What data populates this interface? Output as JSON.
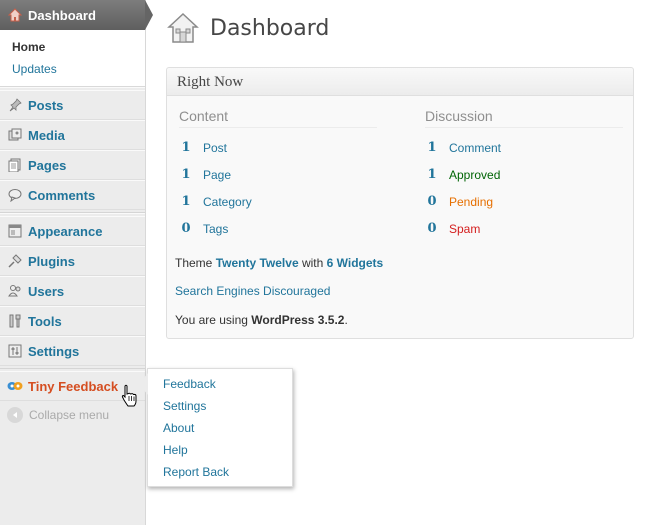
{
  "sidebar": {
    "dashboard_label": "Dashboard",
    "submenu": [
      {
        "label": "Home",
        "current": true
      },
      {
        "label": "Updates",
        "current": false
      }
    ],
    "group1": [
      {
        "label": "Posts",
        "icon": "pushpin-icon"
      },
      {
        "label": "Media",
        "icon": "media-icon"
      },
      {
        "label": "Pages",
        "icon": "pages-icon"
      },
      {
        "label": "Comments",
        "icon": "comment-bubble-icon"
      }
    ],
    "group2": [
      {
        "label": "Appearance",
        "icon": "appearance-icon"
      },
      {
        "label": "Plugins",
        "icon": "plug-icon"
      },
      {
        "label": "Users",
        "icon": "users-icon"
      },
      {
        "label": "Tools",
        "icon": "tools-icon"
      },
      {
        "label": "Settings",
        "icon": "settings-icon"
      }
    ],
    "tiny_feedback_label": "Tiny Feedback",
    "collapse_label": "Collapse menu"
  },
  "flyout": {
    "items": [
      "Feedback",
      "Settings",
      "About",
      "Help",
      "Report Back"
    ]
  },
  "page": {
    "title": "Dashboard"
  },
  "right_now": {
    "title": "Right Now",
    "content_heading": "Content",
    "discussion_heading": "Discussion",
    "content": [
      {
        "count": "1",
        "label": "Post"
      },
      {
        "count": "1",
        "label": "Page"
      },
      {
        "count": "1",
        "label": "Category"
      },
      {
        "count": "0",
        "label": "Tags"
      }
    ],
    "discussion": [
      {
        "count": "1",
        "label": "Comment"
      },
      {
        "count": "1",
        "label": "Approved"
      },
      {
        "count": "0",
        "label": "Pending"
      },
      {
        "count": "0",
        "label": "Spam"
      }
    ],
    "theme_prefix": "Theme",
    "theme_name": "Twenty Twelve",
    "theme_with": "with",
    "widgets_link": "6 Widgets",
    "search_engines": "Search Engines Discouraged",
    "using_prefix": "You are using",
    "wp_version": "WordPress 3.5.2",
    "using_suffix": "."
  },
  "colors": {
    "link": "#21759b",
    "tiny_feedback": "#d54e21",
    "approved": "#006505",
    "pending": "#e66f00",
    "spam": "#d41e1e"
  }
}
